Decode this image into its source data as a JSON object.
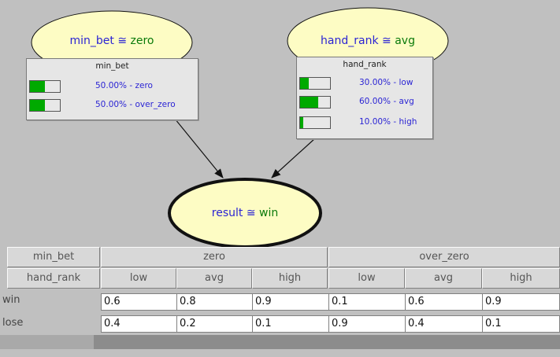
{
  "nodes": {
    "min_bet": {
      "var": "min_bet",
      "op": "≅",
      "value": "zero",
      "box_title": "min_bet",
      "states": [
        {
          "label": "50.00% - zero",
          "prob": 0.5
        },
        {
          "label": "50.00% - over_zero",
          "prob": 0.5
        }
      ]
    },
    "hand_rank": {
      "var": "hand_rank",
      "op": "≅",
      "value": "avg",
      "box_title": "hand_rank",
      "states": [
        {
          "label": "30.00% - low",
          "prob": 0.3
        },
        {
          "label": "60.00% - avg",
          "prob": 0.6
        },
        {
          "label": "10.00% - high",
          "prob": 0.1
        }
      ]
    },
    "result": {
      "var": "result",
      "op": "≅",
      "value": "win"
    }
  },
  "cpt": {
    "header_row1_label": "min_bet",
    "header_row2_label": "hand_rank",
    "groups": [
      "zero",
      "over_zero"
    ],
    "subcols": [
      "low",
      "avg",
      "high",
      "low",
      "avg",
      "high"
    ],
    "rows": [
      {
        "label": "win",
        "values": [
          "0.6",
          "0.8",
          "0.9",
          "0.1",
          "0.6",
          "0.9"
        ]
      },
      {
        "label": "lose",
        "values": [
          "0.4",
          "0.2",
          "0.1",
          "0.9",
          "0.4",
          "0.1"
        ]
      }
    ]
  },
  "colors": {
    "oval_fill": "#fdfcc4",
    "bar_fill": "#00aa00",
    "state_text": "#2b24d4",
    "value_text": "#0a7a0a"
  }
}
